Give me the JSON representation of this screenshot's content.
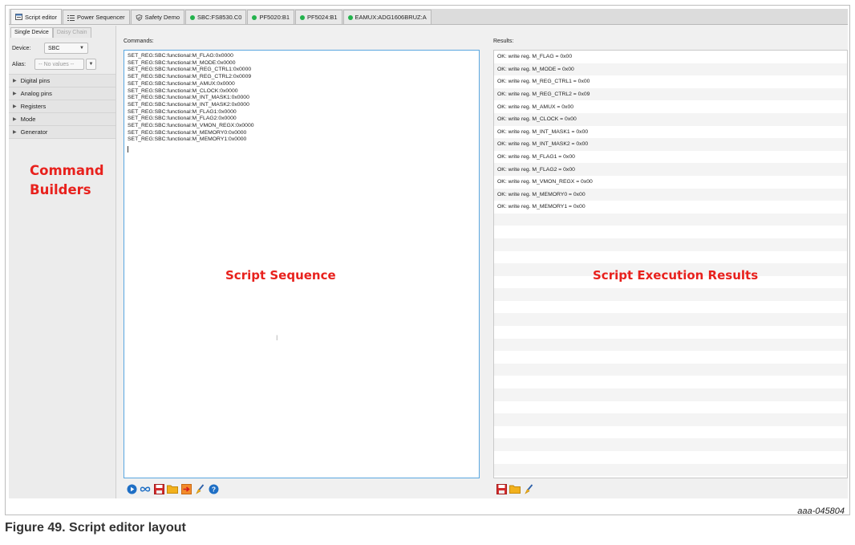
{
  "tabs": [
    {
      "label": "Script editor",
      "icon": "script-editor-icon",
      "active": true
    },
    {
      "label": "Power Sequencer",
      "icon": "list-icon"
    },
    {
      "label": "Safety Demo",
      "icon": "shield-check-icon"
    },
    {
      "label": "SBC:FS8530.C0",
      "icon": "status-dot",
      "color": "#22b24c"
    },
    {
      "label": "PF5020:B1",
      "icon": "status-dot",
      "color": "#22b24c"
    },
    {
      "label": "PF5024:B1",
      "icon": "status-dot",
      "color": "#22b24c"
    },
    {
      "label": "EAMUX:ADG1606BRUZ:A",
      "icon": "status-dot",
      "color": "#22b24c"
    }
  ],
  "sidebar": {
    "subtabs": [
      "Single Device",
      "Daisy Chain"
    ],
    "device_label": "Device:",
    "device_value": "SBC",
    "alias_label": "Alias:",
    "alias_placeholder": "-- No values --",
    "sections": [
      "Digital pins",
      "Analog pins",
      "Registers",
      "Mode",
      "Generator"
    ],
    "annotation": [
      "Command",
      "Builders"
    ]
  },
  "commands": {
    "label": "Commands:",
    "lines": [
      "SET_REG:SBC:functional:M_FLAG:0x0000",
      "SET_REG:SBC:functional:M_MODE:0x0000",
      "SET_REG:SBC:functional:M_REG_CTRL1:0x0000",
      "SET_REG:SBC:functional:M_REG_CTRL2:0x0009",
      "SET_REG:SBC:functional:M_AMUX:0x0000",
      "SET_REG:SBC:functional:M_CLOCK:0x0000",
      "SET_REG:SBC:functional:M_INT_MASK1:0x0000",
      "SET_REG:SBC:functional:M_INT_MASK2:0x0000",
      "SET_REG:SBC:functional:M_FLAG1:0x0000",
      "SET_REG:SBC:functional:M_FLAG2:0x0000",
      "SET_REG:SBC:functional:M_VMON_REGX:0x0000",
      "SET_REG:SBC:functional:M_MEMORY0:0x0000",
      "SET_REG:SBC:functional:M_MEMORY1:0x0000"
    ],
    "annotation": "Script Sequence",
    "toolbar": [
      "play-icon",
      "loop-icon",
      "save-icon",
      "open-folder-icon",
      "import-arrow-icon",
      "clear-brush-icon",
      "help-icon"
    ]
  },
  "results": {
    "label": "Results:",
    "lines": [
      "OK: write reg. M_FLAG = 0x00",
      "OK: write reg. M_MODE = 0x00",
      "OK: write reg. M_REG_CTRL1 = 0x00",
      "OK: write reg. M_REG_CTRL2 = 0x09",
      "OK: write reg. M_AMUX = 0x00",
      "OK: write reg. M_CLOCK = 0x00",
      "OK: write reg. M_INT_MASK1 = 0x00",
      "OK: write reg. M_INT_MASK2 = 0x00",
      "OK: write reg. M_FLAG1 = 0x00",
      "OK: write reg. M_FLAG2 = 0x00",
      "OK: write reg. M_VMON_REGX = 0x00",
      "OK: write reg. M_MEMORY0 = 0x00",
      "OK: write reg. M_MEMORY1 = 0x00"
    ],
    "annotation": "Script Execution Results",
    "toolbar": [
      "save-icon",
      "open-folder-icon",
      "clear-brush-icon"
    ]
  },
  "figure": {
    "code": "aaa-045804",
    "caption": "Figure 49.  Script editor layout"
  }
}
